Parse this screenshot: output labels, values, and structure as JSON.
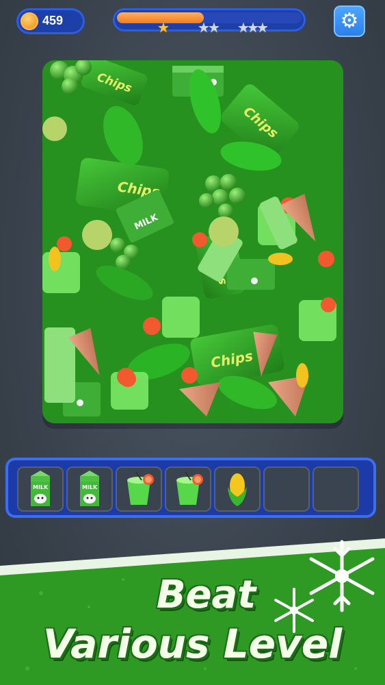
{
  "hud": {
    "coins": "459",
    "coin_icon": "coin-icon",
    "progress_fraction": 0.47,
    "stars_earned": 1,
    "settings_icon": "gear-icon"
  },
  "board": {
    "items": [
      "milk-carton",
      "chips-bag",
      "green-smoothie",
      "broccoli",
      "green-pepper",
      "corn",
      "ice-cream-cone",
      "grapes",
      "pear",
      "paper-cup"
    ]
  },
  "tray": {
    "slots": [
      "milk-carton",
      "milk-carton",
      "green-smoothie",
      "green-smoothie",
      "corn",
      "",
      ""
    ],
    "milk_label": "MILK"
  },
  "banner": {
    "line1": "Beat",
    "line2": "Various Level"
  },
  "colors": {
    "hud_blue": "#1d3fa8",
    "progress_orange": "#f07b1a",
    "star_gold": "#ffc43b",
    "board_green": "#2f9e2a",
    "banner_green": "#2e9a24"
  }
}
